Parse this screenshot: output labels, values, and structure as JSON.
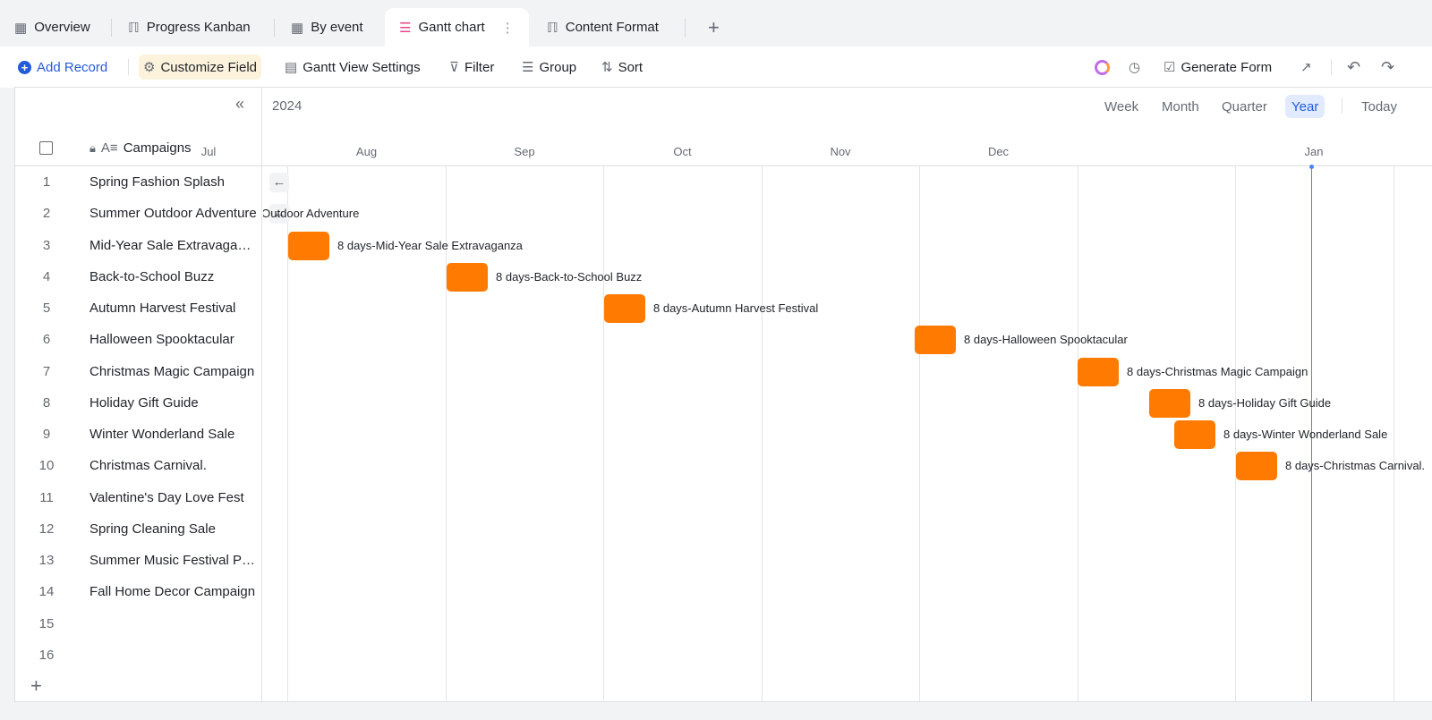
{
  "tabs": [
    {
      "label": "Overview",
      "icon": "grid-icon"
    },
    {
      "label": "Progress Kanban",
      "icon": "kanban-icon"
    },
    {
      "label": "By event",
      "icon": "grid-icon"
    },
    {
      "label": "Gantt chart",
      "icon": "gantt-icon",
      "active": true
    },
    {
      "label": "Content Format",
      "icon": "kanban-icon"
    }
  ],
  "toolbar": {
    "add_record": "Add Record",
    "customize_field": "Customize Field",
    "gantt_settings": "Gantt View Settings",
    "filter": "Filter",
    "group": "Group",
    "sort": "Sort",
    "generate_form": "Generate Form"
  },
  "gantt": {
    "year": "2024",
    "scales": [
      "Week",
      "Month",
      "Quarter",
      "Year"
    ],
    "selected_scale": "Year",
    "today": "Today",
    "months": [
      "Jul",
      "Aug",
      "Sep",
      "Oct",
      "Nov",
      "Dec",
      "Jan"
    ],
    "column_header": "Campaigns",
    "bar_color": "#ff7a00",
    "accent": "#245bdb"
  },
  "rows": [
    {
      "n": "1",
      "name": "Spring Fashion Splash",
      "bar": null
    },
    {
      "n": "2",
      "name": "Summer Outdoor Adventure",
      "bar": null,
      "offscreen": "er Outdoor Adventure"
    },
    {
      "n": "3",
      "name": "Mid-Year Sale Extravaganza",
      "bar": "8 days-Mid-Year Sale Extravaganza"
    },
    {
      "n": "4",
      "name": "Back-to-School Buzz",
      "bar": "8 days-Back-to-School Buzz"
    },
    {
      "n": "5",
      "name": "Autumn Harvest Festival",
      "bar": "8 days-Autumn Harvest Festival"
    },
    {
      "n": "6",
      "name": "Halloween Spooktacular",
      "bar": "8 days-Halloween Spooktacular"
    },
    {
      "n": "7",
      "name": "Christmas Magic Campaign",
      "bar": "8 days-Christmas Magic Campaign"
    },
    {
      "n": "8",
      "name": "Holiday Gift Guide",
      "bar": "8 days-Holiday Gift Guide"
    },
    {
      "n": "9",
      "name": "Winter Wonderland Sale",
      "bar": "8 days-Winter Wonderland Sale"
    },
    {
      "n": "10",
      "name": "Christmas Carnival.",
      "bar": "8 days-Christmas Carnival."
    },
    {
      "n": "11",
      "name": "Valentine's Day Love Fest",
      "bar": null
    },
    {
      "n": "12",
      "name": "Spring Cleaning Sale",
      "bar": null
    },
    {
      "n": "13",
      "name": "Summer Music Festival Promo",
      "bar": null
    },
    {
      "n": "14",
      "name": "Fall Home Decor Campaign",
      "bar": null
    },
    {
      "n": "15",
      "name": "",
      "bar": null
    },
    {
      "n": "16",
      "name": "",
      "bar": null
    }
  ]
}
